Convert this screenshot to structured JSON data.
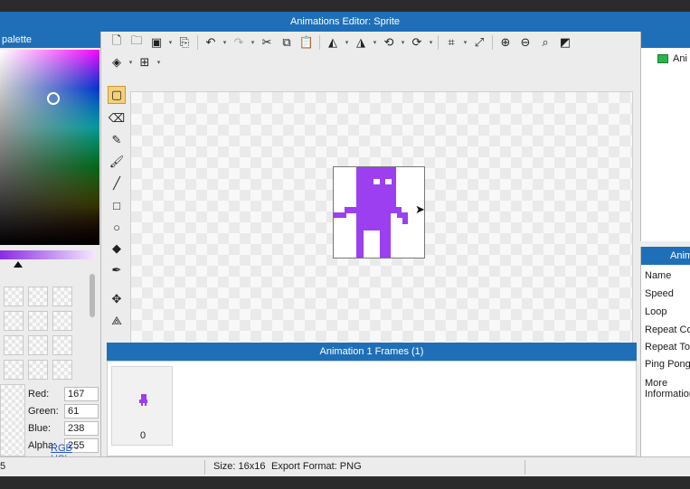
{
  "window": {
    "title": "Animations Editor: Sprite"
  },
  "palette": {
    "title": "palette",
    "fields": [
      {
        "label": "Red:",
        "value": "167"
      },
      {
        "label": "Green:",
        "value": "61"
      },
      {
        "label": "Blue:",
        "value": "238"
      },
      {
        "label": "Alpha:",
        "value": "255"
      }
    ],
    "mode_rgb": "RGB",
    "mode_sep": "-",
    "mode_hsl": "HSL"
  },
  "colors": {
    "sprite": "#9b3ff0",
    "header": "#1f6fb8",
    "animation_swatch": "#2bb34a"
  },
  "toolbar": {
    "row1": [
      "new-file-icon",
      "open-folder-icon",
      "save-icon",
      "export-icon",
      "undo-icon",
      "redo-icon",
      "cut-icon",
      "copy-icon",
      "paste-icon",
      "flip-horizontal-icon",
      "flip-vertical-icon",
      "rotate-left-icon",
      "rotate-right-icon",
      "crop-icon",
      "resize-icon",
      "zoom-in-icon",
      "zoom-out-icon",
      "zoom-fit-icon",
      "toggle-background-icon"
    ],
    "row2": [
      "layers-icon",
      "grid-icon"
    ]
  },
  "tools": [
    "select-icon",
    "eraser-icon",
    "pencil-icon",
    "brush-icon",
    "line-icon",
    "rectangle-icon",
    "ellipse-icon",
    "fill-icon",
    "eyedropper-icon",
    "move-icon",
    "transform-icon"
  ],
  "frames": {
    "title": "Animation 1 Frames (1)",
    "items": [
      {
        "index": "0"
      }
    ]
  },
  "animations_panel": {
    "items": [
      {
        "label": "Ani"
      }
    ]
  },
  "properties_panel": {
    "title": "Anim",
    "rows": [
      "Name",
      "Speed",
      "Loop",
      "Repeat Co",
      "Repeat To",
      "Ping Pong",
      "More",
      "Information"
    ]
  },
  "status": {
    "left_value": "5",
    "size": "Size: 16x16",
    "export_format": "Export Format: PNG"
  }
}
